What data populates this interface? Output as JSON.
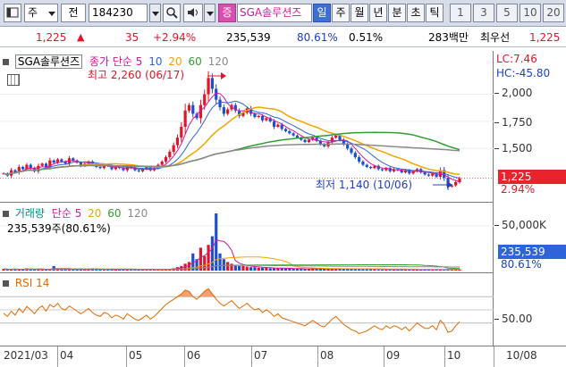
{
  "toolbar": {
    "market_label": "주",
    "jeon_label": "전",
    "code_value": "184230",
    "speaker_icon": "speaker-icon",
    "jeung_label": "증",
    "stock_name": "SGA솔루션즈",
    "period_tabs": [
      "일",
      "주",
      "월",
      "년",
      "분",
      "초",
      "틱"
    ],
    "selected_period": "일",
    "minute_values": [
      "1",
      "3",
      "5",
      "10",
      "20"
    ]
  },
  "quote": {
    "price": "1,225",
    "change": "35",
    "change_pct": "+2.94%",
    "volume": "235,539",
    "volume_ratio": "80.61%",
    "turnover": "0.51%",
    "amount": "283백만",
    "pref_label": "최우선",
    "pref_price": "1,225"
  },
  "price_pane": {
    "title": "SGA솔루션즈",
    "ma_label": "종가 단순",
    "ma_periods": [
      "5",
      "10",
      "20",
      "60",
      "120"
    ],
    "ma_colors": [
      "#d6189a",
      "#2f63d8",
      "#f0a500",
      "#2f9e2f",
      "#8a8a8a"
    ],
    "high_annotation": "최고 2,260 (06/17)",
    "low_annotation": "최저 1,140 (10/06)",
    "lc_label": "LC:7.46",
    "hc_label": "HC:-45.80",
    "y_ticks": [
      "2,000",
      "1,750",
      "1,500"
    ],
    "last_price_tag": "1,225",
    "last_pct_tag": "2.94%"
  },
  "volume_pane": {
    "title": "거래량",
    "ma_label": "단순",
    "ma_periods": [
      "5",
      "20",
      "60",
      "120"
    ],
    "info": "235,539주(80.61%)",
    "y_ticks": [
      "50,000K"
    ],
    "last_volume_tag": "235,539",
    "last_pct_tag": "80.61%"
  },
  "rsi_pane": {
    "title": "RSI 14",
    "y_ticks": [
      "50.00"
    ]
  },
  "date_axis": {
    "labels": [
      "2021/03",
      "04",
      "05",
      "06",
      "07",
      "08",
      "09",
      "10"
    ],
    "right_label": "10/08"
  },
  "chart_data": {
    "type": "candlestick",
    "y_range": [
      1050,
      2350
    ],
    "price_close": [
      1270,
      1250,
      1300,
      1280,
      1330,
      1310,
      1350,
      1320,
      1290,
      1340,
      1360,
      1330,
      1390,
      1370,
      1400,
      1380,
      1360,
      1410,
      1390,
      1370,
      1340,
      1360,
      1380,
      1350,
      1330,
      1320,
      1350,
      1340,
      1310,
      1330,
      1320,
      1300,
      1340,
      1320,
      1300,
      1290,
      1310,
      1330,
      1300,
      1320,
      1350,
      1380,
      1420,
      1470,
      1530,
      1600,
      1700,
      1850,
      1900,
      1820,
      1780,
      1900,
      2000,
      2150,
      2050,
      1950,
      1880,
      1820,
      1860,
      1900,
      1850,
      1800,
      1830,
      1870,
      1820,
      1790,
      1800,
      1760,
      1780,
      1750,
      1700,
      1720,
      1680,
      1660,
      1640,
      1620,
      1600,
      1580,
      1560,
      1580,
      1600,
      1570,
      1540,
      1520,
      1560,
      1600,
      1620,
      1580,
      1540,
      1500,
      1460,
      1420,
      1380,
      1350,
      1330,
      1320,
      1340,
      1310,
      1300,
      1320,
      1290,
      1310,
      1300,
      1280,
      1300,
      1270,
      1290,
      1310,
      1280,
      1260,
      1250,
      1270,
      1240,
      1300,
      1230,
      1150,
      1160,
      1190,
      1225
    ],
    "volume_values": [
      3,
      2,
      2,
      3,
      2,
      2,
      4,
      2,
      2,
      3,
      2,
      2,
      2,
      8,
      3,
      2,
      2,
      2,
      3,
      2,
      2,
      2,
      2,
      4,
      2,
      2,
      2,
      2,
      2,
      2,
      2,
      2,
      2,
      2,
      2,
      2,
      2,
      2,
      2,
      2,
      2,
      2,
      3,
      3,
      4,
      6,
      8,
      12,
      15,
      30,
      20,
      40,
      25,
      45,
      60,
      100,
      30,
      20,
      15,
      12,
      10,
      8,
      8,
      7,
      6,
      6,
      5,
      5,
      5,
      4,
      4,
      4,
      4,
      4,
      4,
      3,
      3,
      3,
      3,
      3,
      4,
      3,
      3,
      3,
      3,
      3,
      3,
      3,
      3,
      3,
      3,
      3,
      3,
      3,
      3,
      3,
      3,
      2,
      2,
      2,
      2,
      2,
      2,
      2,
      2,
      2,
      2,
      2,
      2,
      2,
      2,
      2,
      2,
      2,
      2,
      3,
      3,
      2,
      2
    ],
    "rsi_values": [
      45,
      40,
      48,
      42,
      52,
      46,
      55,
      50,
      44,
      52,
      56,
      48,
      58,
      54,
      60,
      52,
      50,
      56,
      52,
      48,
      44,
      48,
      52,
      46,
      42,
      40,
      46,
      44,
      38,
      42,
      40,
      36,
      44,
      40,
      36,
      34,
      38,
      42,
      36,
      40,
      46,
      52,
      58,
      62,
      66,
      70,
      74,
      80,
      78,
      70,
      66,
      72,
      78,
      82,
      74,
      66,
      60,
      56,
      60,
      64,
      58,
      52,
      56,
      60,
      54,
      50,
      52,
      46,
      50,
      46,
      40,
      44,
      38,
      36,
      34,
      32,
      30,
      28,
      26,
      30,
      34,
      30,
      26,
      24,
      30,
      36,
      40,
      34,
      28,
      24,
      20,
      18,
      14,
      16,
      18,
      22,
      26,
      22,
      20,
      26,
      22,
      26,
      24,
      20,
      24,
      18,
      24,
      30,
      26,
      22,
      22,
      26,
      20,
      34,
      28,
      16,
      18,
      26,
      32
    ],
    "rsi_range": [
      0,
      100
    ],
    "rsi_reference": 50,
    "high": {
      "date": "06/17",
      "value": 2260
    },
    "low": {
      "date": "10/06",
      "value": 1140
    }
  }
}
